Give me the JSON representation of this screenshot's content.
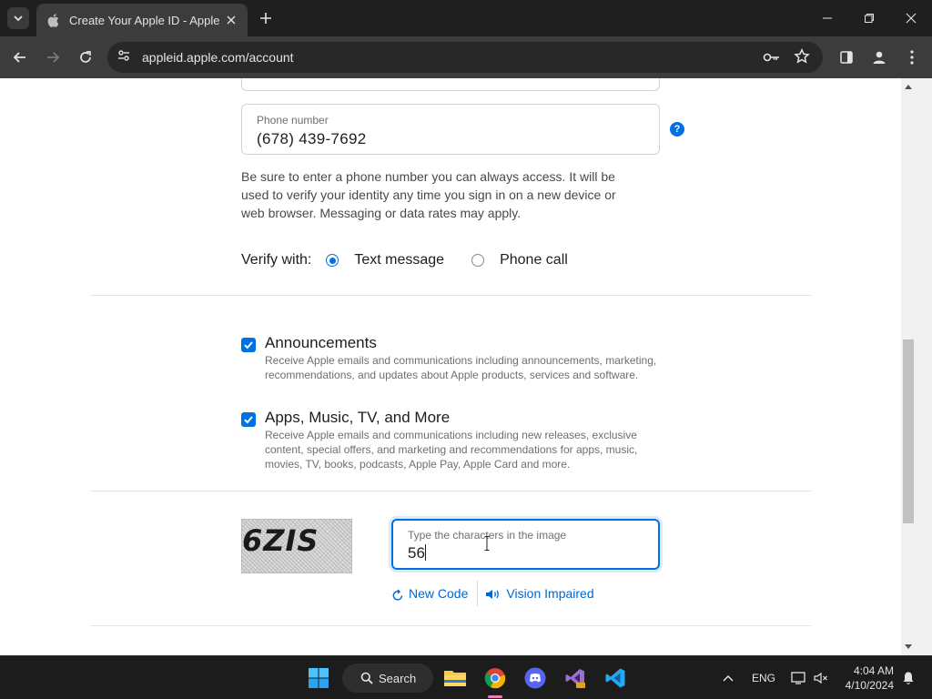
{
  "browser": {
    "tab_title": "Create Your Apple ID - Apple",
    "url": "appleid.apple.com/account"
  },
  "phone": {
    "label": "Phone number",
    "value": "(678) 439-7692",
    "help_glyph": "?",
    "note": "Be sure to enter a phone number you can always access. It will be used to verify your identity any time you sign in on a new device or web browser. Messaging or data rates may apply."
  },
  "verify": {
    "label": "Verify with:",
    "options": [
      "Text message",
      "Phone call"
    ],
    "selected": "Text message"
  },
  "subscriptions": [
    {
      "title": "Announcements",
      "description": "Receive Apple emails and communications including announcements, marketing, recommendations, and updates about Apple products, services and software.",
      "checked": true
    },
    {
      "title": "Apps, Music, TV, and More",
      "description": "Receive Apple emails and communications including new releases, exclusive content, special offers, and marketing and recommendations for apps, music, movies, TV, books, podcasts, Apple Pay, Apple Card and more.",
      "checked": true
    }
  ],
  "captcha": {
    "image_text": "6ZIS",
    "field_label": "Type the characters in the image",
    "field_value": "56",
    "new_code": "New Code",
    "vision_impaired": "Vision Impaired"
  },
  "taskbar": {
    "search_label": "Search",
    "language": "ENG",
    "time": "4:04 AM",
    "date": "4/10/2024"
  },
  "colors": {
    "accent": "#0071e3",
    "link": "#0066cc",
    "chrome_dark": "#1f1f1f"
  }
}
